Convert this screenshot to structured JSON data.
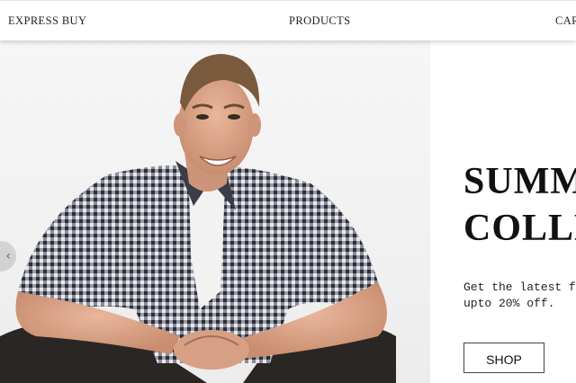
{
  "nav": {
    "brand": "EXPRESS BUY",
    "products": "PRODUCTS",
    "cart": "CART"
  },
  "hero": {
    "title_line1": "SUMMER",
    "title_line2": "COLLECTION",
    "text_line1": "Get the latest fashion",
    "text_line2": "upto 20% off.",
    "button_label": "SHOP NOW",
    "prev_icon": "‹",
    "image_subject": "smiling man in checked shirt sitting"
  },
  "colors": {
    "text": "#111111",
    "background": "#ffffff"
  }
}
